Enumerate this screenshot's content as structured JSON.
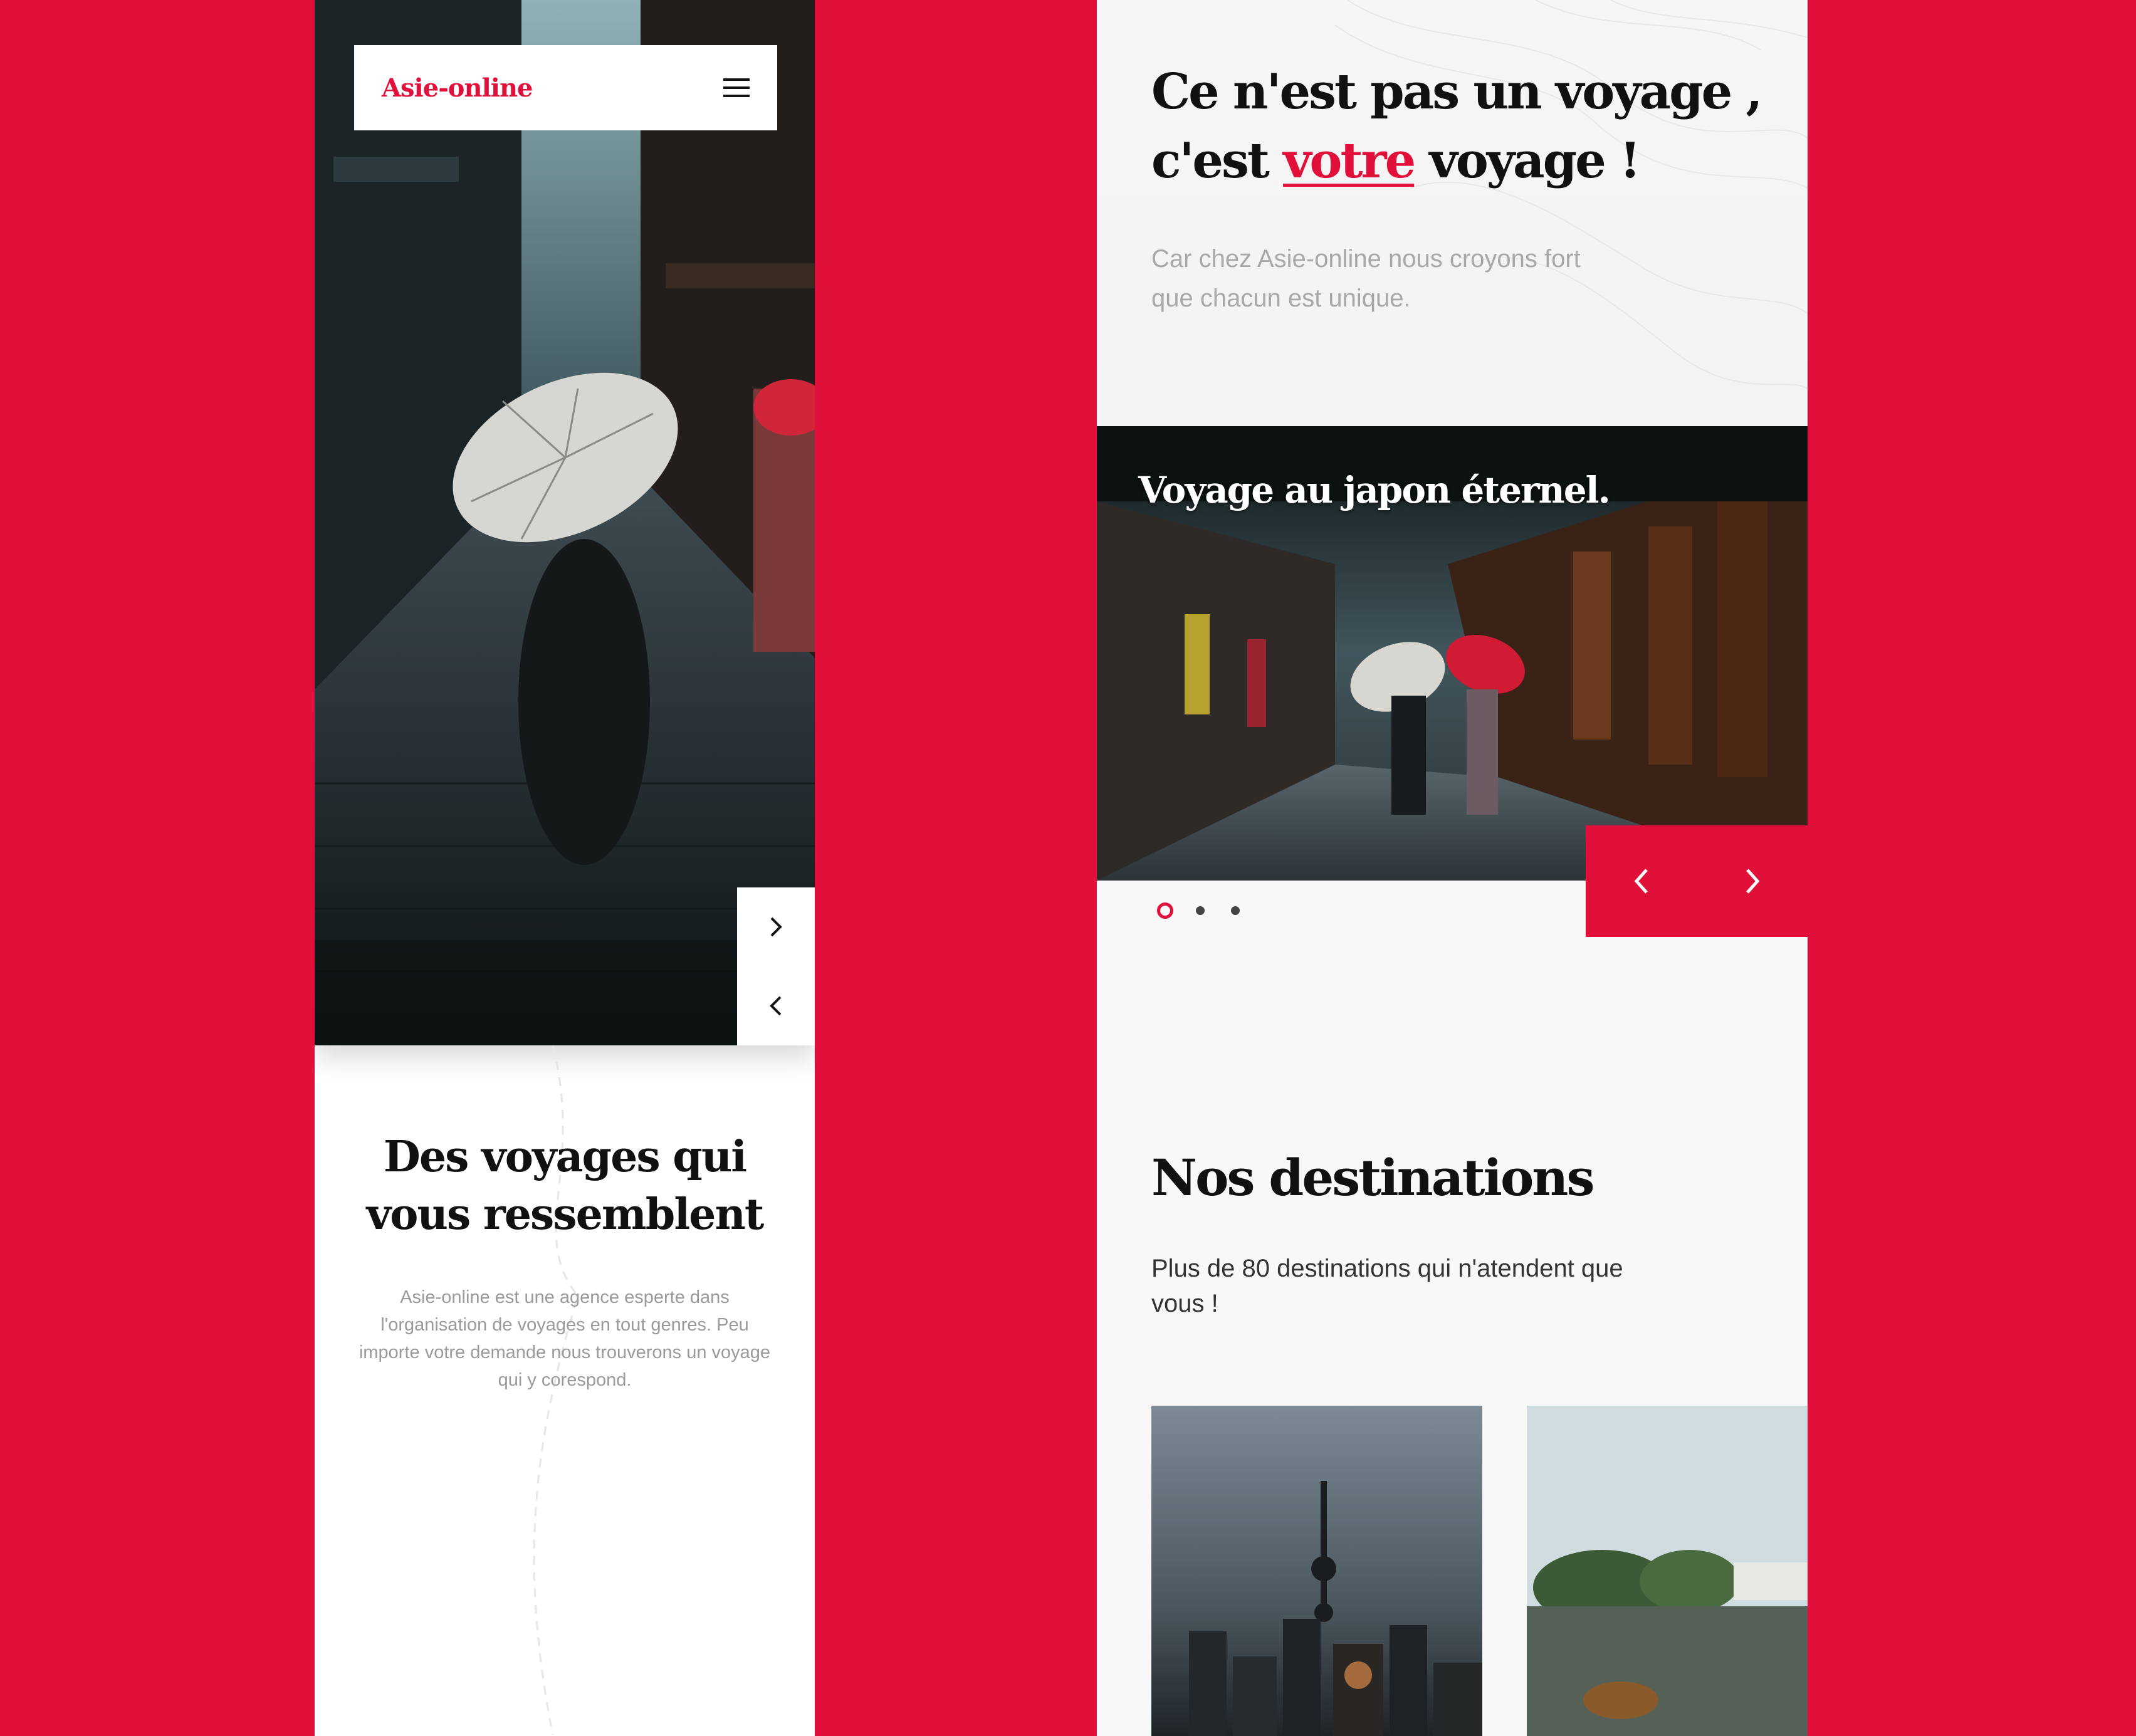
{
  "colors": {
    "brand": "#e0103a",
    "background": "#e0103a",
    "text_dark": "#111111",
    "text_muted": "#a8a8a8"
  },
  "left_screen": {
    "logo": "Asie-online",
    "menu_icon": "hamburger-menu-icon",
    "hero_next_icon": "chevron-right-icon",
    "hero_prev_icon": "chevron-left-icon",
    "intro": {
      "title": "Des voyages qui vous ressemblent",
      "text": "Asie-online est une agence esperte dans l'organisation de voyages en tout genres. Peu importe votre demande nous trouverons un voyage qui y corespond."
    }
  },
  "right_screen": {
    "headline_part1": "Ce n'est pas un voyage ,",
    "headline_part2_pre": "c'est ",
    "headline_accent": "votre",
    "headline_part2_post": " voyage !",
    "tagline": "Car chez Asie-online nous croyons fort que chacun est unique.",
    "slider": {
      "title": "Voyage au japon éternel.",
      "prev_icon": "chevron-left-icon",
      "next_icon": "chevron-right-icon",
      "dots_count": 3,
      "active_dot": 1
    },
    "destinations": {
      "title": "Nos destinations",
      "subtitle": "Plus de 80 destinations qui n'atendent que vous !"
    }
  }
}
